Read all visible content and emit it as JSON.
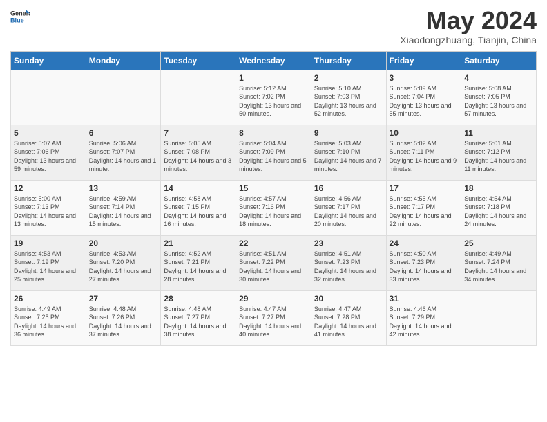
{
  "header": {
    "logo_general": "General",
    "logo_blue": "Blue",
    "month": "May 2024",
    "location": "Xiaodongzhuang, Tianjin, China"
  },
  "days_of_week": [
    "Sunday",
    "Monday",
    "Tuesday",
    "Wednesday",
    "Thursday",
    "Friday",
    "Saturday"
  ],
  "weeks": [
    [
      {
        "day": "",
        "details": ""
      },
      {
        "day": "",
        "details": ""
      },
      {
        "day": "",
        "details": ""
      },
      {
        "day": "1",
        "details": "Sunrise: 5:12 AM\nSunset: 7:02 PM\nDaylight: 13 hours and 50 minutes."
      },
      {
        "day": "2",
        "details": "Sunrise: 5:10 AM\nSunset: 7:03 PM\nDaylight: 13 hours and 52 minutes."
      },
      {
        "day": "3",
        "details": "Sunrise: 5:09 AM\nSunset: 7:04 PM\nDaylight: 13 hours and 55 minutes."
      },
      {
        "day": "4",
        "details": "Sunrise: 5:08 AM\nSunset: 7:05 PM\nDaylight: 13 hours and 57 minutes."
      }
    ],
    [
      {
        "day": "5",
        "details": "Sunrise: 5:07 AM\nSunset: 7:06 PM\nDaylight: 13 hours and 59 minutes."
      },
      {
        "day": "6",
        "details": "Sunrise: 5:06 AM\nSunset: 7:07 PM\nDaylight: 14 hours and 1 minute."
      },
      {
        "day": "7",
        "details": "Sunrise: 5:05 AM\nSunset: 7:08 PM\nDaylight: 14 hours and 3 minutes."
      },
      {
        "day": "8",
        "details": "Sunrise: 5:04 AM\nSunset: 7:09 PM\nDaylight: 14 hours and 5 minutes."
      },
      {
        "day": "9",
        "details": "Sunrise: 5:03 AM\nSunset: 7:10 PM\nDaylight: 14 hours and 7 minutes."
      },
      {
        "day": "10",
        "details": "Sunrise: 5:02 AM\nSunset: 7:11 PM\nDaylight: 14 hours and 9 minutes."
      },
      {
        "day": "11",
        "details": "Sunrise: 5:01 AM\nSunset: 7:12 PM\nDaylight: 14 hours and 11 minutes."
      }
    ],
    [
      {
        "day": "12",
        "details": "Sunrise: 5:00 AM\nSunset: 7:13 PM\nDaylight: 14 hours and 13 minutes."
      },
      {
        "day": "13",
        "details": "Sunrise: 4:59 AM\nSunset: 7:14 PM\nDaylight: 14 hours and 15 minutes."
      },
      {
        "day": "14",
        "details": "Sunrise: 4:58 AM\nSunset: 7:15 PM\nDaylight: 14 hours and 16 minutes."
      },
      {
        "day": "15",
        "details": "Sunrise: 4:57 AM\nSunset: 7:16 PM\nDaylight: 14 hours and 18 minutes."
      },
      {
        "day": "16",
        "details": "Sunrise: 4:56 AM\nSunset: 7:17 PM\nDaylight: 14 hours and 20 minutes."
      },
      {
        "day": "17",
        "details": "Sunrise: 4:55 AM\nSunset: 7:17 PM\nDaylight: 14 hours and 22 minutes."
      },
      {
        "day": "18",
        "details": "Sunrise: 4:54 AM\nSunset: 7:18 PM\nDaylight: 14 hours and 24 minutes."
      }
    ],
    [
      {
        "day": "19",
        "details": "Sunrise: 4:53 AM\nSunset: 7:19 PM\nDaylight: 14 hours and 25 minutes."
      },
      {
        "day": "20",
        "details": "Sunrise: 4:53 AM\nSunset: 7:20 PM\nDaylight: 14 hours and 27 minutes."
      },
      {
        "day": "21",
        "details": "Sunrise: 4:52 AM\nSunset: 7:21 PM\nDaylight: 14 hours and 28 minutes."
      },
      {
        "day": "22",
        "details": "Sunrise: 4:51 AM\nSunset: 7:22 PM\nDaylight: 14 hours and 30 minutes."
      },
      {
        "day": "23",
        "details": "Sunrise: 4:51 AM\nSunset: 7:23 PM\nDaylight: 14 hours and 32 minutes."
      },
      {
        "day": "24",
        "details": "Sunrise: 4:50 AM\nSunset: 7:23 PM\nDaylight: 14 hours and 33 minutes."
      },
      {
        "day": "25",
        "details": "Sunrise: 4:49 AM\nSunset: 7:24 PM\nDaylight: 14 hours and 34 minutes."
      }
    ],
    [
      {
        "day": "26",
        "details": "Sunrise: 4:49 AM\nSunset: 7:25 PM\nDaylight: 14 hours and 36 minutes."
      },
      {
        "day": "27",
        "details": "Sunrise: 4:48 AM\nSunset: 7:26 PM\nDaylight: 14 hours and 37 minutes."
      },
      {
        "day": "28",
        "details": "Sunrise: 4:48 AM\nSunset: 7:27 PM\nDaylight: 14 hours and 38 minutes."
      },
      {
        "day": "29",
        "details": "Sunrise: 4:47 AM\nSunset: 7:27 PM\nDaylight: 14 hours and 40 minutes."
      },
      {
        "day": "30",
        "details": "Sunrise: 4:47 AM\nSunset: 7:28 PM\nDaylight: 14 hours and 41 minutes."
      },
      {
        "day": "31",
        "details": "Sunrise: 4:46 AM\nSunset: 7:29 PM\nDaylight: 14 hours and 42 minutes."
      },
      {
        "day": "",
        "details": ""
      }
    ]
  ]
}
